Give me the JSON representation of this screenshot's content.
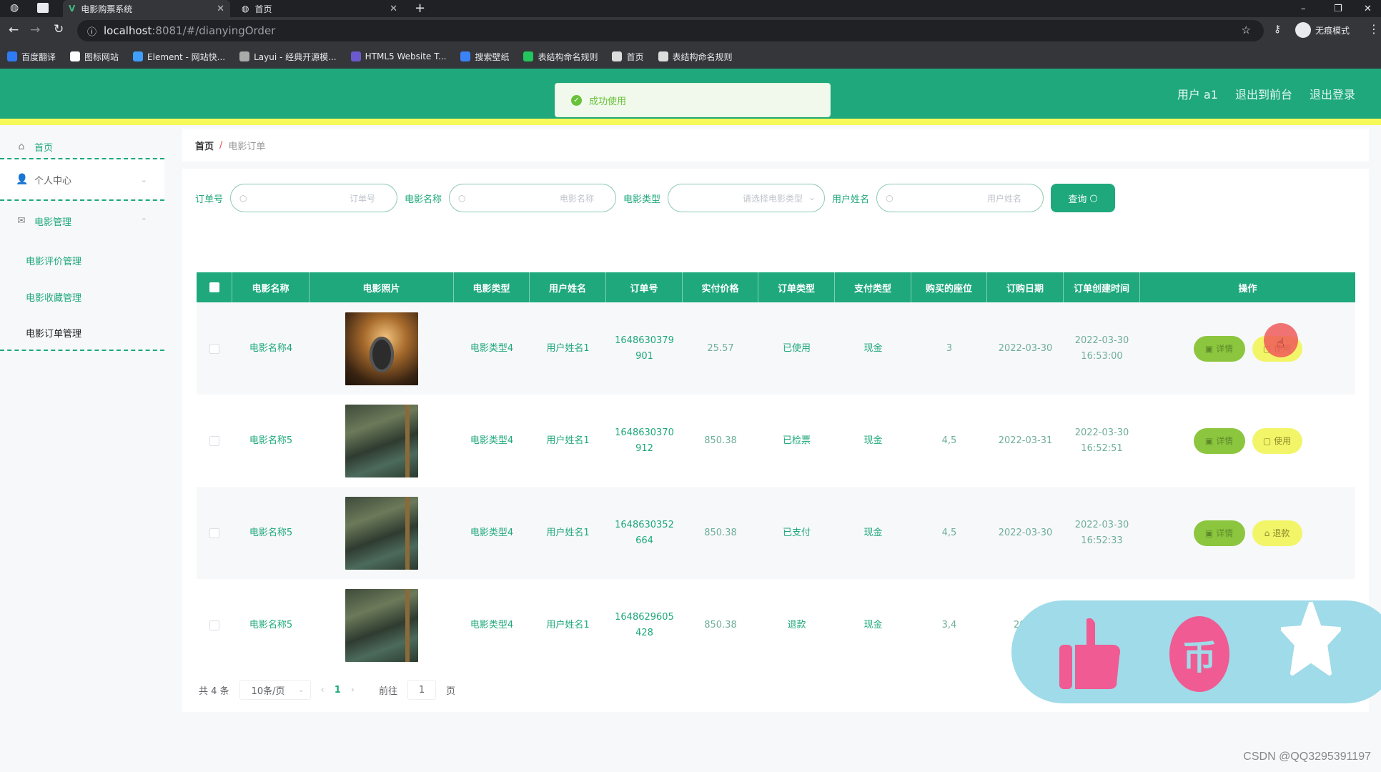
{
  "browser": {
    "tabs": [
      {
        "title": "电影购票系统",
        "icon": "vue-logo-icon",
        "active": true
      },
      {
        "title": "首页",
        "icon": "globe-icon",
        "active": false
      }
    ],
    "new_tab": "+",
    "url_host": "localhost",
    "url_rest": ":8081/#/dianyingOrder",
    "incognito_label": "无痕模式",
    "window_controls": [
      "–",
      "❐",
      "✕"
    ],
    "bookmarks": [
      {
        "label": "百度翻译",
        "color": "#2f7bf6"
      },
      {
        "label": "图标网站",
        "color": "#ffffff"
      },
      {
        "label": "Element - 网站快...",
        "color": "#409eff"
      },
      {
        "label": "Layui - 经典开源模...",
        "color": "#aaaaaa"
      },
      {
        "label": "HTML5 Website T...",
        "color": "#6a5acd"
      },
      {
        "label": "搜索壁纸",
        "color": "#3b82f6"
      },
      {
        "label": "表结构命名规则",
        "color": "#22c55e"
      },
      {
        "label": "首页",
        "color": "#dddddd"
      },
      {
        "label": "表结构命名规则",
        "color": "#dddddd"
      }
    ]
  },
  "header": {
    "user": "用户 a1",
    "to_front": "退出到前台",
    "logout": "退出登录",
    "colors": {
      "primary": "#1ea87c",
      "stripe": "#f5f95a"
    }
  },
  "toast": {
    "message": "成功使用",
    "type": "success"
  },
  "sidebar": {
    "items": [
      {
        "label": "首页",
        "icon": "home-icon"
      },
      {
        "label": "个人中心",
        "icon": "user-icon",
        "chevron": "⌄"
      },
      {
        "label": "电影管理",
        "icon": "mail-icon",
        "chevron": "⌃"
      }
    ],
    "sub_items": [
      {
        "label": "电影评价管理",
        "active": false
      },
      {
        "label": "电影收藏管理",
        "active": false
      },
      {
        "label": "电影订单管理",
        "active": true
      }
    ]
  },
  "breadcrumb": {
    "home": "首页",
    "separator": "/",
    "current": "电影订单"
  },
  "search": {
    "fields": [
      {
        "label": "订单号",
        "placeholder": "订单号"
      },
      {
        "label": "电影名称",
        "placeholder": "电影名称"
      },
      {
        "label": "电影类型",
        "placeholder": "请选择电影类型",
        "type": "select"
      },
      {
        "label": "用户姓名",
        "placeholder": "用户姓名"
      }
    ],
    "query_button": "查询"
  },
  "table": {
    "columns": [
      "电影名称",
      "电影照片",
      "电影类型",
      "用户姓名",
      "订单号",
      "实付价格",
      "订单类型",
      "支付类型",
      "购买的座位",
      "订购日期",
      "订单创建时间",
      "操作"
    ],
    "rows": [
      {
        "name": "电影名称4",
        "poster": "clapperboard",
        "type": "电影类型4",
        "user": "用户姓名1",
        "order_no_1": "1648630379",
        "order_no_2": "901",
        "price": "25.57",
        "order_type": "已使用",
        "pay_type": "现金",
        "seats": "3",
        "date": "2022-03-30",
        "created_1": "2022-03-30",
        "created_2": "16:53:00",
        "detail": "详情",
        "action": "使用"
      },
      {
        "name": "电影名称5",
        "poster": "scene",
        "type": "电影类型4",
        "user": "用户姓名1",
        "order_no_1": "1648630370",
        "order_no_2": "912",
        "price": "850.38",
        "order_type": "已检票",
        "pay_type": "现金",
        "seats": "4,5",
        "date": "2022-03-31",
        "created_1": "2022-03-30",
        "created_2": "16:52:51",
        "detail": "详情",
        "action": "使用"
      },
      {
        "name": "电影名称5",
        "poster": "scene",
        "type": "电影类型4",
        "user": "用户姓名1",
        "order_no_1": "1648630352",
        "order_no_2": "664",
        "price": "850.38",
        "order_type": "已支付",
        "pay_type": "现金",
        "seats": "4,5",
        "date": "2022-03-30",
        "created_1": "2022-03-30",
        "created_2": "16:52:33",
        "detail": "详情",
        "action": "退款"
      },
      {
        "name": "电影名称5",
        "poster": "scene",
        "type": "电影类型4",
        "user": "用户姓名1",
        "order_no_1": "1648629605",
        "order_no_2": "428",
        "price": "850.38",
        "order_type": "退款",
        "pay_type": "现金",
        "seats": "3,4",
        "date": "2022",
        "created_1": "",
        "created_2": "",
        "detail": "",
        "action": ""
      }
    ]
  },
  "pagination": {
    "total": "共 4 条",
    "page_size": "10条/页",
    "prev": "‹",
    "current": "1",
    "next": "›",
    "goto_label": "前往",
    "goto_value": "1",
    "page_suffix": "页"
  },
  "floating_widget": {
    "like": "thumbs-up",
    "coin": "币",
    "favorite": "star"
  },
  "watermark": "CSDN @QQ3295391197"
}
